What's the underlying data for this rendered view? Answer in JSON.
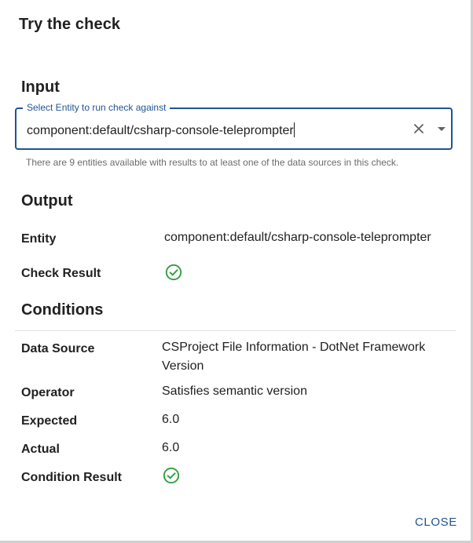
{
  "dialog": {
    "title": "Try the check",
    "close_label": "CLOSE"
  },
  "input": {
    "heading": "Input",
    "entity_field": {
      "label": "Select Entity to run check against",
      "value": "component:default/csharp-console-teleprompter"
    },
    "helper_text": "There are 9 entities available with results to at least one of the data sources in this check."
  },
  "output": {
    "heading": "Output",
    "entity_label": "Entity",
    "entity_value": "component:default/csharp-console-teleprompter",
    "check_result_label": "Check Result",
    "check_result_icon": "check-circle-icon",
    "check_result_status": "pass"
  },
  "conditions": {
    "heading": "Conditions",
    "rows": {
      "data_source": {
        "label": "Data Source",
        "value_line1": "CSProject File Information - DotNet Framework",
        "value_line2": "Version"
      },
      "operator": {
        "label": "Operator",
        "value": "Satisfies semantic version"
      },
      "expected": {
        "label": "Expected",
        "value": "6.0"
      },
      "actual": {
        "label": "Actual",
        "value": "6.0"
      },
      "condition_result": {
        "label": "Condition Result",
        "icon": "check-circle-icon",
        "status": "pass"
      }
    }
  },
  "colors": {
    "accent": "#1f5493",
    "success": "#2e9e3e"
  }
}
